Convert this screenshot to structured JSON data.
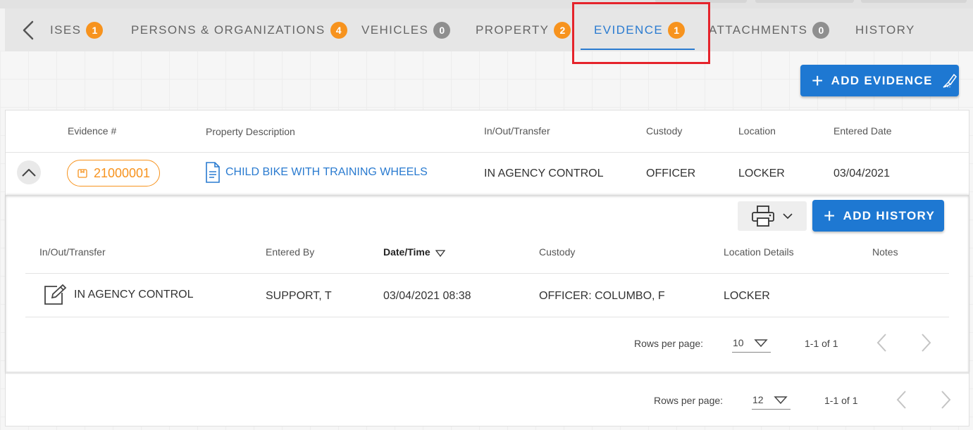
{
  "tabs": [
    {
      "label": "ISES",
      "count": "1",
      "badge_color": "orange"
    },
    {
      "label": "PERSONS & ORGANIZATIONS",
      "count": "4",
      "badge_color": "orange"
    },
    {
      "label": "VEHICLES",
      "count": "0",
      "badge_color": "grey"
    },
    {
      "label": "PROPERTY",
      "count": "2",
      "badge_color": "orange"
    },
    {
      "label": "EVIDENCE",
      "count": "1",
      "badge_color": "orange",
      "active": true
    },
    {
      "label": "ATTACHMENTS",
      "count": "0",
      "badge_color": "grey"
    },
    {
      "label": "HISTORY"
    }
  ],
  "add_evidence_label": "ADD EVIDENCE",
  "evidence_table": {
    "headers": [
      "Evidence #",
      "Property Description",
      "In/Out/Transfer",
      "Custody",
      "Location",
      "Entered Date"
    ],
    "row": {
      "evidence_number": "21000001",
      "property_description": "CHILD BIKE WITH TRAINING WHEELS",
      "in_out_transfer": "IN AGENCY CONTROL",
      "custody": "OFFICER",
      "location": "LOCKER",
      "entered_date": "03/04/2021"
    }
  },
  "history": {
    "add_history_label": "ADD HISTORY",
    "headers": [
      "In/Out/Transfer",
      "Entered By",
      "Date/Time",
      "Custody",
      "Location Details",
      "Notes"
    ],
    "row": {
      "in_out_transfer": "IN AGENCY CONTROL",
      "entered_by": "SUPPORT, T",
      "date_time": "03/04/2021 08:38",
      "custody": "OFFICER: COLUMBO, F",
      "location_details": "LOCKER",
      "notes": ""
    },
    "pager": {
      "rows_per_page_label": "Rows per page:",
      "rows_per_page": "10",
      "range": "1-1 of 1"
    }
  },
  "outer_pager": {
    "rows_per_page_label": "Rows per page:",
    "rows_per_page": "12",
    "range": "1-1 of 1"
  },
  "colors": {
    "accent": "#1e78d2",
    "badge_orange": "#f7931e",
    "badge_grey": "#8f8f8f",
    "highlight": "#e5232b"
  }
}
